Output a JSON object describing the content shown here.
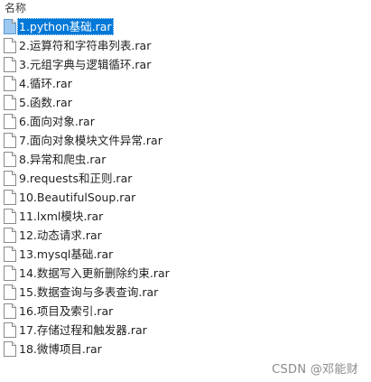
{
  "header": {
    "column_name": "名称"
  },
  "files": [
    {
      "name": "1.python基础.rar",
      "selected": true
    },
    {
      "name": "2.运算符和字符串列表.rar",
      "selected": false
    },
    {
      "name": "3.元组字典与逻辑循环.rar",
      "selected": false
    },
    {
      "name": "4.循环.rar",
      "selected": false
    },
    {
      "name": "5.函数.rar",
      "selected": false
    },
    {
      "name": "6.面向对象.rar",
      "selected": false
    },
    {
      "name": "7.面向对象模块文件异常.rar",
      "selected": false
    },
    {
      "name": "8.异常和爬虫.rar",
      "selected": false
    },
    {
      "name": "9.requests和正则.rar",
      "selected": false
    },
    {
      "name": "10.BeautifulSoup.rar",
      "selected": false
    },
    {
      "name": "11.lxml模块.rar",
      "selected": false
    },
    {
      "name": "12.动态请求.rar",
      "selected": false
    },
    {
      "name": "13.mysql基础.rar",
      "selected": false
    },
    {
      "name": "14.数据写入更新删除约束.rar",
      "selected": false
    },
    {
      "name": "15.数据查询与多表查询.rar",
      "selected": false
    },
    {
      "name": "16.项目及索引.rar",
      "selected": false
    },
    {
      "name": "17.存储过程和触发器.rar",
      "selected": false
    },
    {
      "name": "18.微博项目.rar",
      "selected": false
    }
  ],
  "icons": {
    "file": "file-icon"
  },
  "watermark": "CSDN @邓能财",
  "colors": {
    "selection": "#0078d7",
    "text": "#1f1f1f",
    "watermark": "#8a8a8a"
  }
}
